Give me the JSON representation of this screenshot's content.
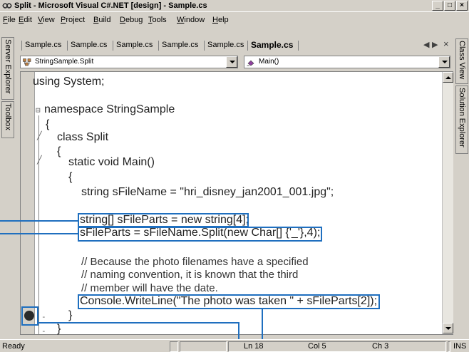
{
  "window": {
    "title": "Split - Microsoft Visual C#.NET [design] - Sample.cs",
    "controls": [
      "_",
      "□",
      "×"
    ]
  },
  "menu": [
    {
      "key": "F",
      "rest": "ile"
    },
    {
      "key": "E",
      "rest": "dit"
    },
    {
      "key": "V",
      "rest": "iew"
    },
    {
      "key": "P",
      "rest": "roject"
    },
    {
      "key": "B",
      "rest": "uild"
    },
    {
      "key": "D",
      "rest": "ebug"
    },
    {
      "key": "T",
      "rest": "ools"
    },
    {
      "key": "W",
      "rest": "indow"
    },
    {
      "key": "H",
      "rest": "elp"
    }
  ],
  "left_tabs": [
    "Server Explorer",
    "Toolbox"
  ],
  "right_tabs": [
    "Class View",
    "Solution Explorer"
  ],
  "doc_tabs": [
    "Sample.cs",
    "Sample.cs",
    "Sample.cs",
    "Sample.cs",
    "Sample.cs",
    "Sample.cs"
  ],
  "doc_nav": {
    "prev": "◀",
    "next": "▶",
    "close": "×"
  },
  "combos": {
    "class_value": "StringSample.Split",
    "member_value": "Main()"
  },
  "code": [
    "using System;",
    "namespace StringSample",
    "{",
    "class Split",
    "{",
    "static void Main()",
    "{",
    "string sFileName = \"hri_disney_jan2001_001.jpg\";",
    "string[] sFileParts = new string[4];",
    "sFileParts = sFileName.Split(new Char[] {'_'},4);",
    "// Because the photo filenames have a specified",
    "// naming convention, it is known that the third",
    "// member will have the date.",
    "Console.WriteLine(\"The photo was taken \" + sFileParts[2]);",
    "}",
    "}"
  ],
  "status": {
    "ready": "Ready",
    "line": "Ln 18",
    "col": "Col 5",
    "ch": "Ch 3",
    "mode": "INS"
  },
  "colors": {
    "chrome": "#d4d0c8",
    "highlight": "#1f6fbf"
  }
}
